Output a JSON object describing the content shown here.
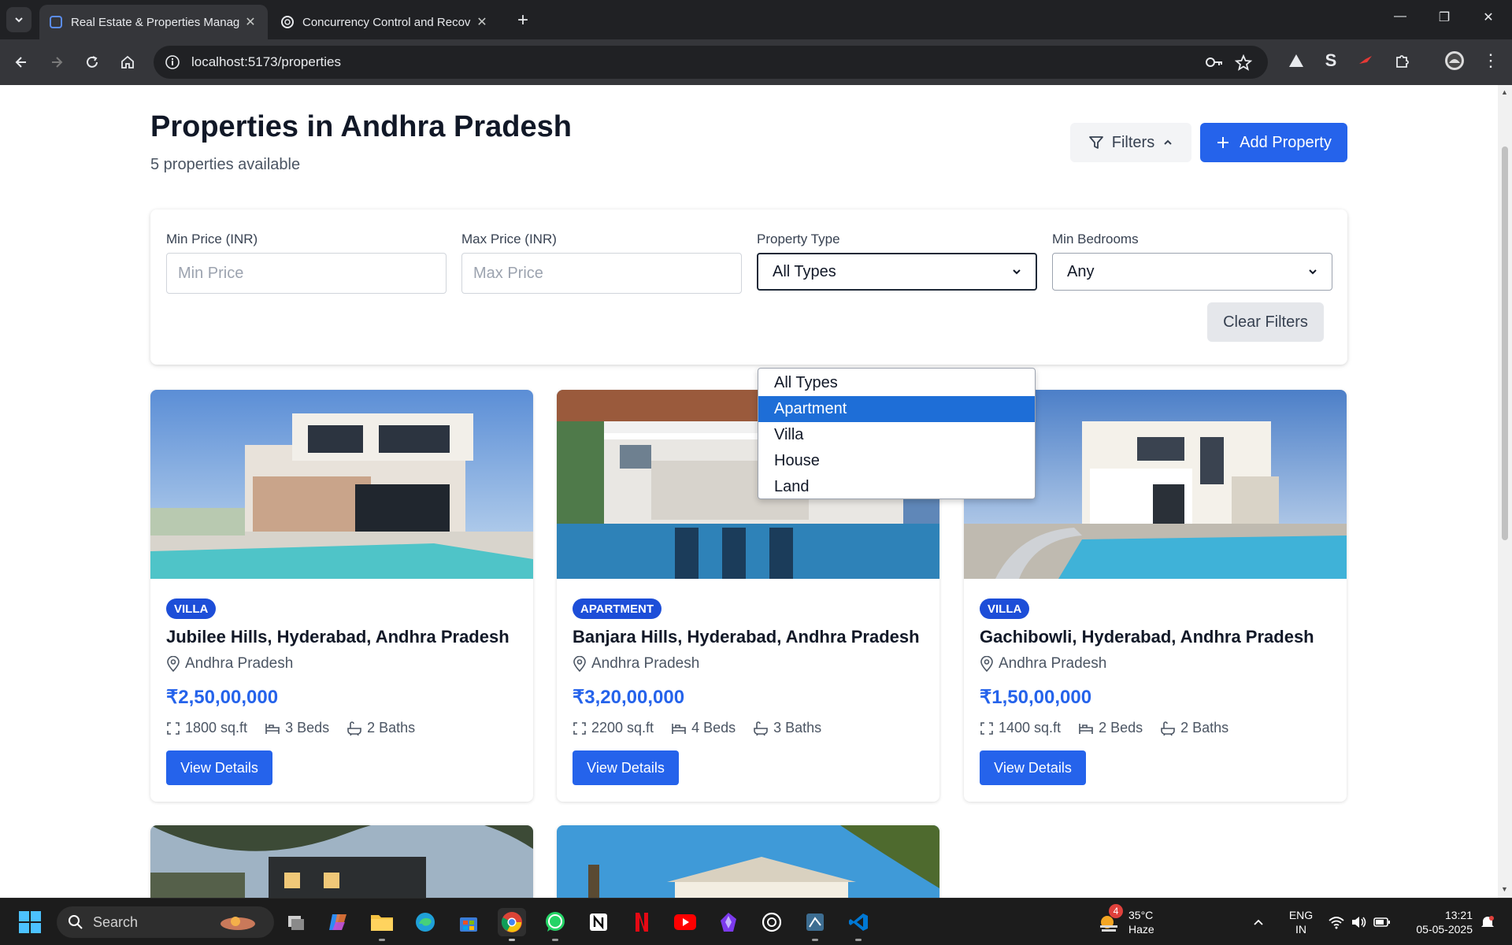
{
  "browser": {
    "tabs": [
      {
        "title": "Real Estate & Properties Manag",
        "active": true
      },
      {
        "title": "Concurrency Control and Recov",
        "active": false
      }
    ],
    "url": "localhost:5173/properties"
  },
  "header": {
    "title": "Properties in Andhra Pradesh",
    "subtitle": "5 properties available",
    "filters_label": "Filters",
    "add_label": "Add Property"
  },
  "filters": {
    "min_price_label": "Min Price (INR)",
    "min_price_placeholder": "Min Price",
    "max_price_label": "Max Price (INR)",
    "max_price_placeholder": "Max Price",
    "type_label": "Property Type",
    "type_value": "All Types",
    "bedrooms_label": "Min Bedrooms",
    "bedrooms_value": "Any",
    "clear_label": "Clear Filters",
    "type_options": [
      "All Types",
      "Apartment",
      "Villa",
      "House",
      "Land"
    ],
    "highlighted_option": "Apartment"
  },
  "properties": [
    {
      "badge": "VILLA",
      "title": "Jubilee Hills, Hyderabad, Andhra Pradesh",
      "location": "Andhra Pradesh",
      "price": "₹2,50,00,000",
      "area": "1800 sq.ft",
      "beds": "3 Beds",
      "baths": "2 Baths",
      "button": "View Details"
    },
    {
      "badge": "APARTMENT",
      "title": "Banjara Hills, Hyderabad, Andhra Pradesh",
      "location": "Andhra Pradesh",
      "price": "₹3,20,00,000",
      "area": "2200 sq.ft",
      "beds": "4 Beds",
      "baths": "3 Baths",
      "button": "View Details"
    },
    {
      "badge": "VILLA",
      "title": "Gachibowli, Hyderabad, Andhra Pradesh",
      "location": "Andhra Pradesh",
      "price": "₹1,50,00,000",
      "area": "1400 sq.ft",
      "beds": "2 Beds",
      "baths": "2 Baths",
      "button": "View Details"
    }
  ],
  "taskbar": {
    "search_label": "Search",
    "weather_temp": "35°C",
    "weather_desc": "Haze",
    "weather_badge": "4",
    "lang_1": "ENG",
    "lang_2": "IN",
    "time": "13:21",
    "date": "05-05-2025"
  },
  "colors": {
    "primary": "#2563eb",
    "badge": "#1d4ed8",
    "dropdown_highlight": "#1e6ed7"
  }
}
